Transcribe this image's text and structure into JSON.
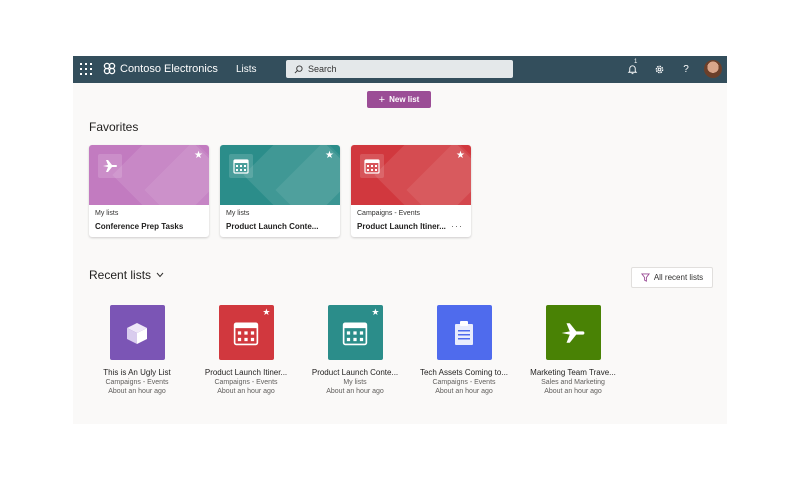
{
  "topbar": {
    "brand": "Contoso Electronics",
    "nav_item": "Lists",
    "search_placeholder": "Search",
    "notification_count": "1"
  },
  "new_list_label": "New list",
  "favorites": {
    "heading": "Favorites",
    "cards": [
      {
        "subtitle": "My lists",
        "title": "Conference Prep Tasks",
        "color": "#c27bc0",
        "icon": "airplane-icon"
      },
      {
        "subtitle": "My lists",
        "title": "Product Launch Conte...",
        "color": "#2b8d8a",
        "icon": "calendar-icon"
      },
      {
        "subtitle": "Campaigns - Events",
        "title": "Product Launch Itiner...",
        "color": "#d1383e",
        "icon": "calendar-icon",
        "more": "···"
      }
    ]
  },
  "recent": {
    "heading": "Recent lists",
    "all_label": "All recent lists",
    "items": [
      {
        "title": "This is An Ugly List",
        "location": "Campaigns - Events",
        "time": "About an hour ago",
        "color": "#7b55b5",
        "icon": "cube-icon",
        "favorite": false
      },
      {
        "title": "Product Launch Itiner...",
        "location": "Campaigns - Events",
        "time": "About an hour ago",
        "color": "#d1383e",
        "icon": "calendar-icon",
        "favorite": true
      },
      {
        "title": "Product Launch Conte...",
        "location": "My lists",
        "time": "About an hour ago",
        "color": "#2b8d8a",
        "icon": "calendar-icon",
        "favorite": true
      },
      {
        "title": "Tech Assets Coming to...",
        "location": "Campaigns - Events",
        "time": "About an hour ago",
        "color": "#4f6bed",
        "icon": "clipboard-icon",
        "favorite": false
      },
      {
        "title": "Marketing Team Trave...",
        "location": "Sales and Marketing",
        "time": "About an hour ago",
        "color": "#498205",
        "icon": "airplane-icon",
        "favorite": false
      }
    ]
  }
}
